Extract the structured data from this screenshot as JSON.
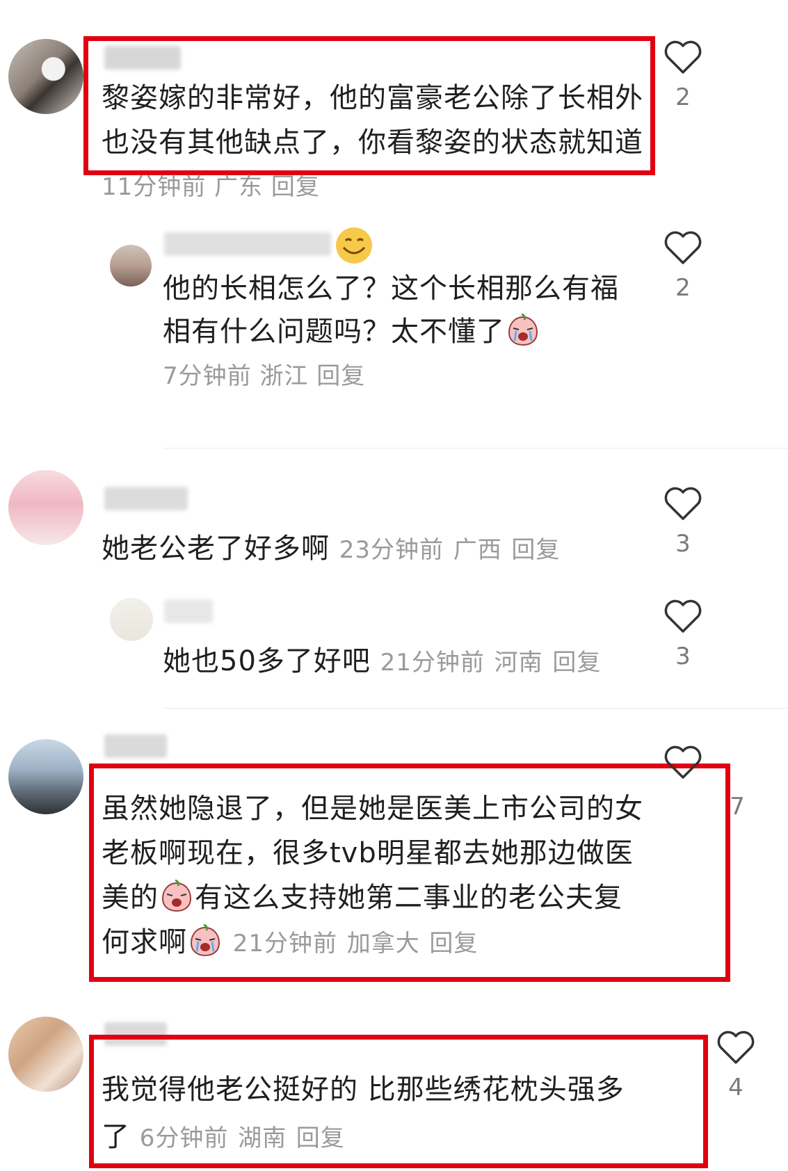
{
  "comments": [
    {
      "text_lines": [
        "黎姿嫁的非常好，他的富豪老公除了长相外",
        "也没有其他缺点了，你看黎姿的状态就知道"
      ],
      "time": "11分钟前",
      "location": "广东",
      "reply": "回复",
      "likes": "2"
    },
    {
      "text_lines": [
        "他的长相怎么了？这个长相那么有福",
        "相有什么问题吗？太不懂了"
      ],
      "time": "7分钟前",
      "location": "浙江",
      "reply": "回复",
      "likes": "2"
    },
    {
      "text": "她老公老了好多啊",
      "time": "23分钟前",
      "location": "广西",
      "reply": "回复",
      "likes": "3"
    },
    {
      "text": "她也50多了好吧",
      "time": "21分钟前",
      "location": "河南",
      "reply": "回复",
      "likes": "3"
    },
    {
      "text_lines": [
        "虽然她隐退了，但是她是医美上市公司的女",
        "老板啊现在，很多tvb明星都去她那边做医",
        "美的",
        "有这么支持她第二事业的老公夫复",
        "何求啊"
      ],
      "time": "21分钟前",
      "location": "加拿大",
      "reply": "回复",
      "likes": "7"
    },
    {
      "text_lines": [
        "我觉得他老公挺好的 比那些绣花枕头强多",
        "了"
      ],
      "time": "6分钟前",
      "location": "湖南",
      "reply": "回复",
      "likes": "4"
    }
  ],
  "icons": {
    "like": "heart-outline-icon",
    "emoji_smile": "smiling-emoji-icon",
    "emoji_cry": "crying-emoji-icon"
  },
  "colors": {
    "highlight_box": "#e00012",
    "meta_text": "#9a9a9a",
    "body_text": "#1f1f1f"
  }
}
